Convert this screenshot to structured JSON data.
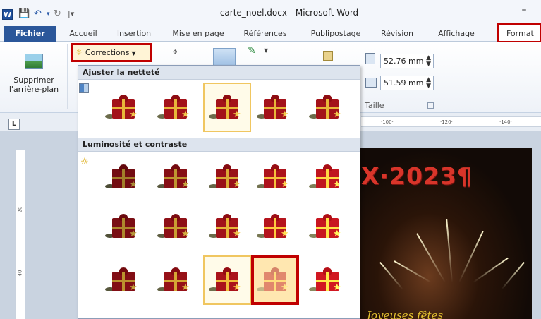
{
  "window": {
    "title": "carte_noel.docx - Microsoft Word",
    "app_icon": "W",
    "minimize": "–"
  },
  "quick_access": {
    "save_icon": "save-icon",
    "undo_icon": "undo-icon",
    "redo_icon": "redo-icon",
    "customize_icon": "customize-icon"
  },
  "tabs": [
    {
      "label": "Fichier"
    },
    {
      "label": "Accueil"
    },
    {
      "label": "Insertion"
    },
    {
      "label": "Mise en page"
    },
    {
      "label": "Références"
    },
    {
      "label": "Publipostage"
    },
    {
      "label": "Révision"
    },
    {
      "label": "Affichage"
    },
    {
      "label": "Format"
    }
  ],
  "ribbon": {
    "remove_background_label": "Supprimer l'arrière-plan",
    "corrections_label": "Corrections",
    "height_value": "52.76 mm",
    "width_value": "51.59 mm",
    "size_group_label": "Taille"
  },
  "gallery": {
    "sharpness_header": "Ajuster la netteté",
    "brightness_header": "Luminosité et contraste",
    "sharpness_selected_index": 2,
    "brightness_selected": {
      "row": 2,
      "col": 2
    },
    "brightness_hover": {
      "row": 2,
      "col": 3
    }
  },
  "ruler": {
    "horizontal_labels": [
      "·100·",
      "·120·",
      "·140·"
    ],
    "vertical_labels": [
      "20",
      "40"
    ],
    "tab_marker": "L"
  },
  "document": {
    "heading_text": "X·2023¶",
    "script_text": "Joyeuses fêtes"
  },
  "colors": {
    "file_tab": "#2b579a",
    "highlight_border": "#c00000",
    "selected_border": "#f0c660"
  }
}
